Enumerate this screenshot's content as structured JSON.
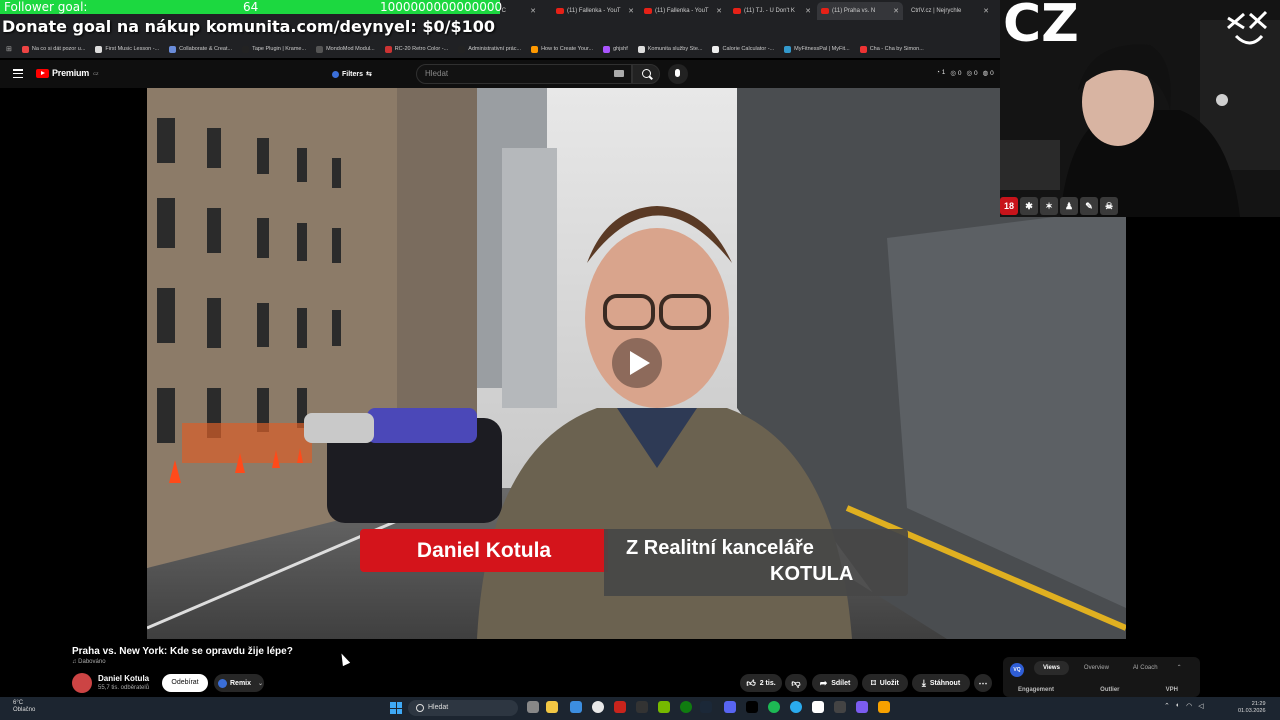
{
  "overlay": {
    "follower_label": "Follower goal:",
    "follower_current": "64",
    "follower_target": "1000000000000000",
    "follower_progress": 6e-14,
    "donate_text": "Donate goal na nákup komunita.com/deynyel: $0/$100"
  },
  "browser": {
    "tabs": [
      {
        "label": "DEN BEZ C",
        "active": false
      },
      {
        "label": "(11) Fallenka - YouT",
        "active": false
      },
      {
        "label": "(11) Fallenka - YouT",
        "active": false
      },
      {
        "label": "(11) TJ. - U Don't K",
        "active": false
      },
      {
        "label": "(11) Praha vs. N",
        "active": true
      },
      {
        "label": "CtrlV.cz | Nejrychle",
        "active": false
      }
    ],
    "bookmarks": [
      "Na co si dát pozor u...",
      "First Music Lesson -...",
      "Collaborate & Creat...",
      "Tape Plugin | Krame...",
      "MondoMod Modul...",
      "RC-20 Retro Color -...",
      "Administrativní prác...",
      "How to Create Your...",
      "ghjshf",
      "Komunita služby Ste...",
      "Calorie Calculator -...",
      "MyFitnessPal | MyFit...",
      "Cha - Cha by Simon..."
    ]
  },
  "youtube": {
    "logo_text": "Premium",
    "logo_sup": "CZ",
    "filters_label": "Filters",
    "search_placeholder": "Hledat",
    "stats": [
      "1",
      "0",
      "0",
      "0"
    ],
    "video": {
      "lower_third_name": "Daniel Kotula",
      "lower_third_line1": "Z Realitní kanceláře",
      "lower_third_line2": "KOTULA"
    },
    "title": "Praha vs. New York: Kde se opravdu žije lépe?",
    "dub_label": "Dabováno",
    "channel_name": "Daniel Kotula",
    "subscribers": "55,7 tis. odběratelů",
    "subscribe_label": "Odebírat",
    "remix_label": "Remix",
    "like_count": "2 tis.",
    "share_label": "Sdílet",
    "save_label": "Uložit",
    "download_label": "Stáhnout"
  },
  "analytics": {
    "icon_text": "VQ",
    "tabs": [
      "Views",
      "Overview",
      "AI Coach"
    ],
    "active_tab": "Views",
    "columns": [
      "Engagement",
      "Outlier",
      "VPH"
    ]
  },
  "webcam": {
    "label": "CZ",
    "badge_18": "18"
  },
  "taskbar": {
    "weather_temp": "6°C",
    "weather_desc": "Oblačno",
    "search_label": "Hledat",
    "time": "21:29",
    "date": "01.03.2026"
  },
  "colors": {
    "follower_fill": "#1cd840",
    "youtube_red": "#ff0000",
    "lower_third_red": "#d4141b"
  }
}
